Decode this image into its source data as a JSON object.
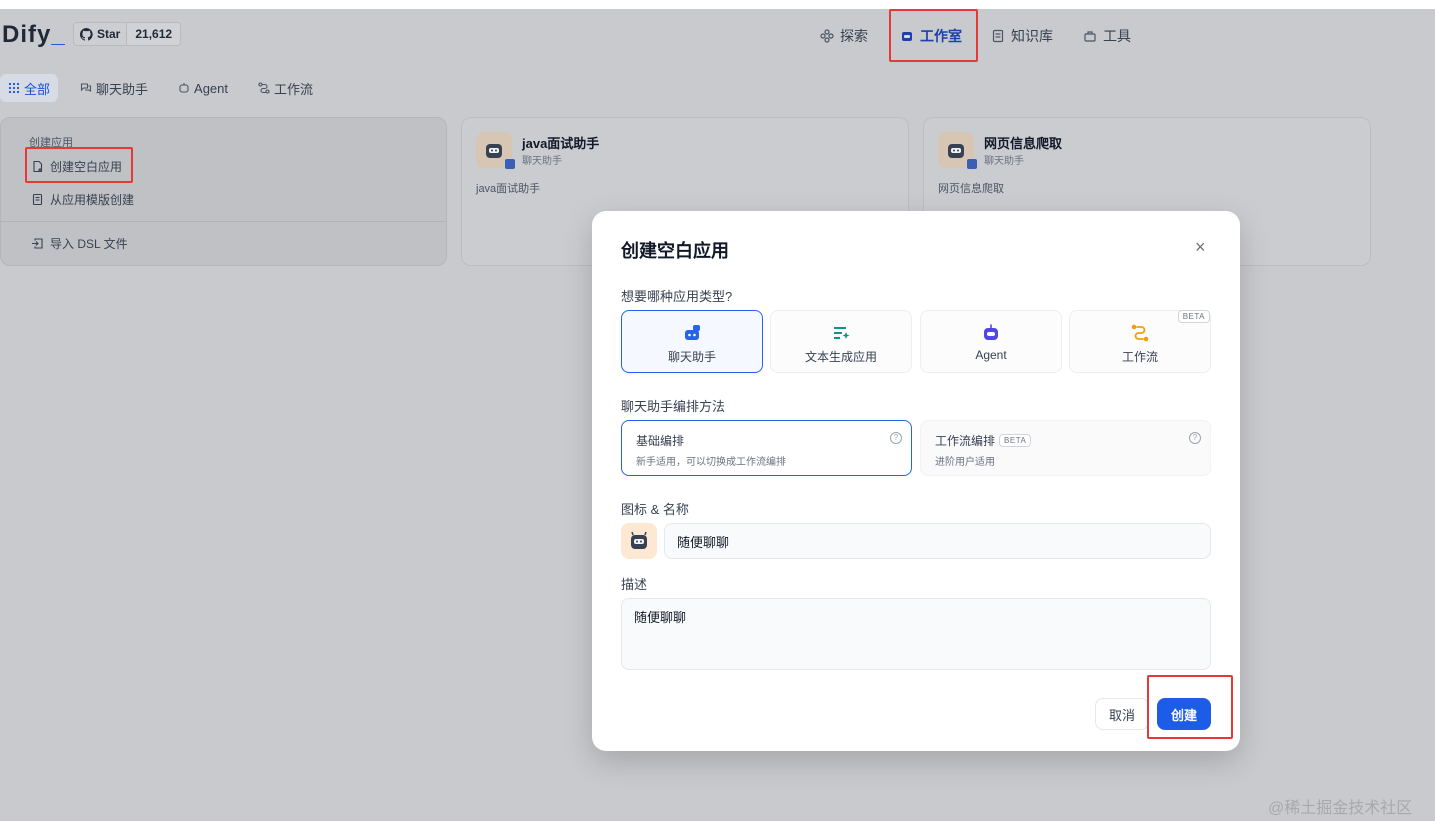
{
  "header": {
    "logo": "Dify",
    "logo_suffix": "_",
    "github": {
      "label": "Star",
      "count": "21,612"
    },
    "nav": [
      {
        "label": "探索",
        "icon": "explore-icon"
      },
      {
        "label": "工作室",
        "icon": "studio-robot-icon"
      },
      {
        "label": "知识库",
        "icon": "book-icon"
      },
      {
        "label": "工具",
        "icon": "toolbox-icon"
      }
    ]
  },
  "filters": [
    "全部",
    "聊天助手",
    "Agent",
    "工作流"
  ],
  "create_card": {
    "title": "创建应用",
    "items": [
      "创建空白应用",
      "从应用模版创建",
      "导入 DSL 文件"
    ]
  },
  "apps": [
    {
      "name": "java面试助手",
      "type": "聊天助手",
      "desc": "java面试助手"
    },
    {
      "name": "网页信息爬取",
      "type": "聊天助手",
      "desc": "网页信息爬取"
    }
  ],
  "modal": {
    "title": "创建空白应用",
    "type_question": "想要哪种应用类型?",
    "types": [
      {
        "label": "聊天助手",
        "icon": "chat-assistant-icon",
        "color": "#2563eb"
      },
      {
        "label": "文本生成应用",
        "icon": "text-generation-icon",
        "color": "#0d9488"
      },
      {
        "label": "Agent",
        "icon": "agent-robot-icon",
        "color": "#4f46e5"
      },
      {
        "label": "工作流",
        "icon": "workflow-icon",
        "color": "#f59e0b",
        "badge": "BETA"
      }
    ],
    "mode_label": "聊天助手编排方法",
    "modes": [
      {
        "title": "基础编排",
        "desc": "新手适用，可以切换成工作流编排"
      },
      {
        "title": "工作流编排",
        "badge": "BETA",
        "desc": "进阶用户适用"
      }
    ],
    "name_label": "图标 & 名称",
    "name_value": "随便聊聊",
    "desc_label": "描述",
    "desc_value": "随便聊聊",
    "cancel": "取消",
    "create": "创建",
    "close_glyph": "×"
  },
  "colors": {
    "primary": "#1d5ce6",
    "highlight": "#e53935"
  },
  "watermark": "@稀土掘金技术社区"
}
